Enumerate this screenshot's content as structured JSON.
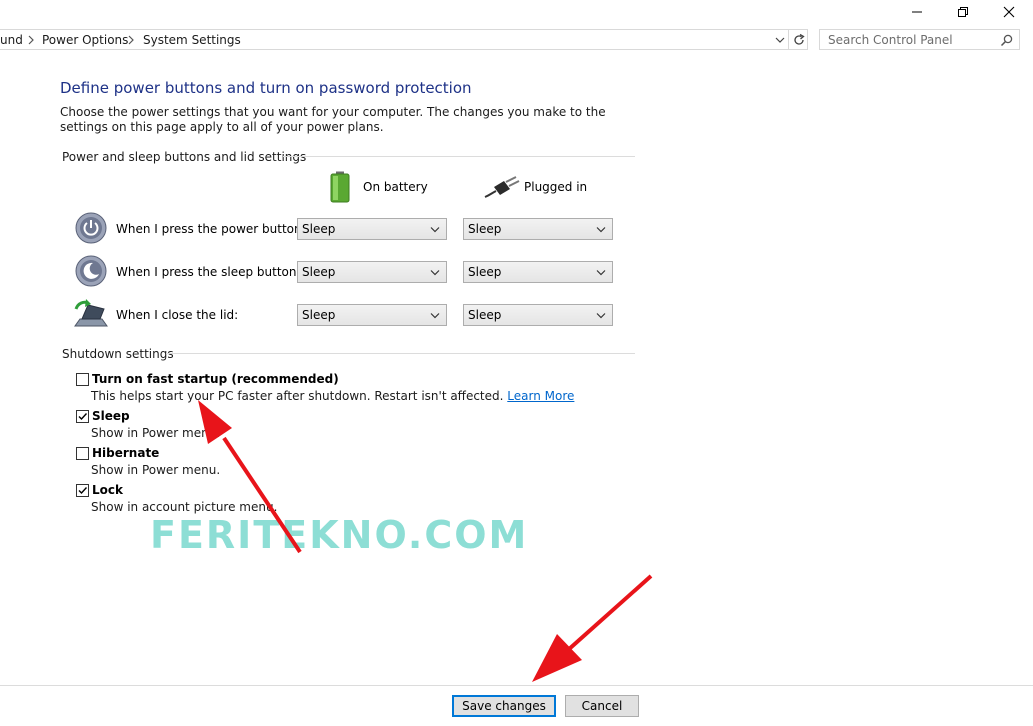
{
  "address_bar": {
    "breadcrumbs": [
      "und",
      "Power Options",
      "System Settings"
    ]
  },
  "search": {
    "placeholder": "Search Control Panel"
  },
  "page": {
    "title": "Define power buttons and turn on password protection",
    "description": "Choose the power settings that you want for your computer. The changes you make to the settings on this page apply to all of your power plans."
  },
  "power_section": {
    "heading": "Power and sleep buttons and lid settings",
    "col_battery": "On battery",
    "col_plugged": "Plugged in",
    "rows": [
      {
        "label": "When I press the power button:",
        "battery": "Sleep",
        "plugged": "Sleep"
      },
      {
        "label": "When I press the sleep button:",
        "battery": "Sleep",
        "plugged": "Sleep"
      },
      {
        "label": "When I close the lid:",
        "battery": "Sleep",
        "plugged": "Sleep"
      }
    ]
  },
  "shutdown_section": {
    "heading": "Shutdown settings",
    "options": [
      {
        "title": "Turn on fast startup (recommended)",
        "sub": "This helps start your PC faster after shutdown. Restart isn't affected.",
        "link": "Learn More",
        "checked": false
      },
      {
        "title": "Sleep",
        "sub": "Show in Power menu.",
        "checked": true
      },
      {
        "title": "Hibernate",
        "sub": "Show in Power menu.",
        "checked": false
      },
      {
        "title": "Lock",
        "sub": "Show in account picture menu.",
        "checked": true
      }
    ]
  },
  "watermark": "FERITEKNO.COM",
  "footer": {
    "save_label": "Save changes",
    "cancel_label": "Cancel"
  },
  "colors": {
    "title_blue": "#1e3287",
    "link_blue": "#0066cc",
    "arrow_red": "#e8141a",
    "watermark_teal": "#8dded5"
  }
}
